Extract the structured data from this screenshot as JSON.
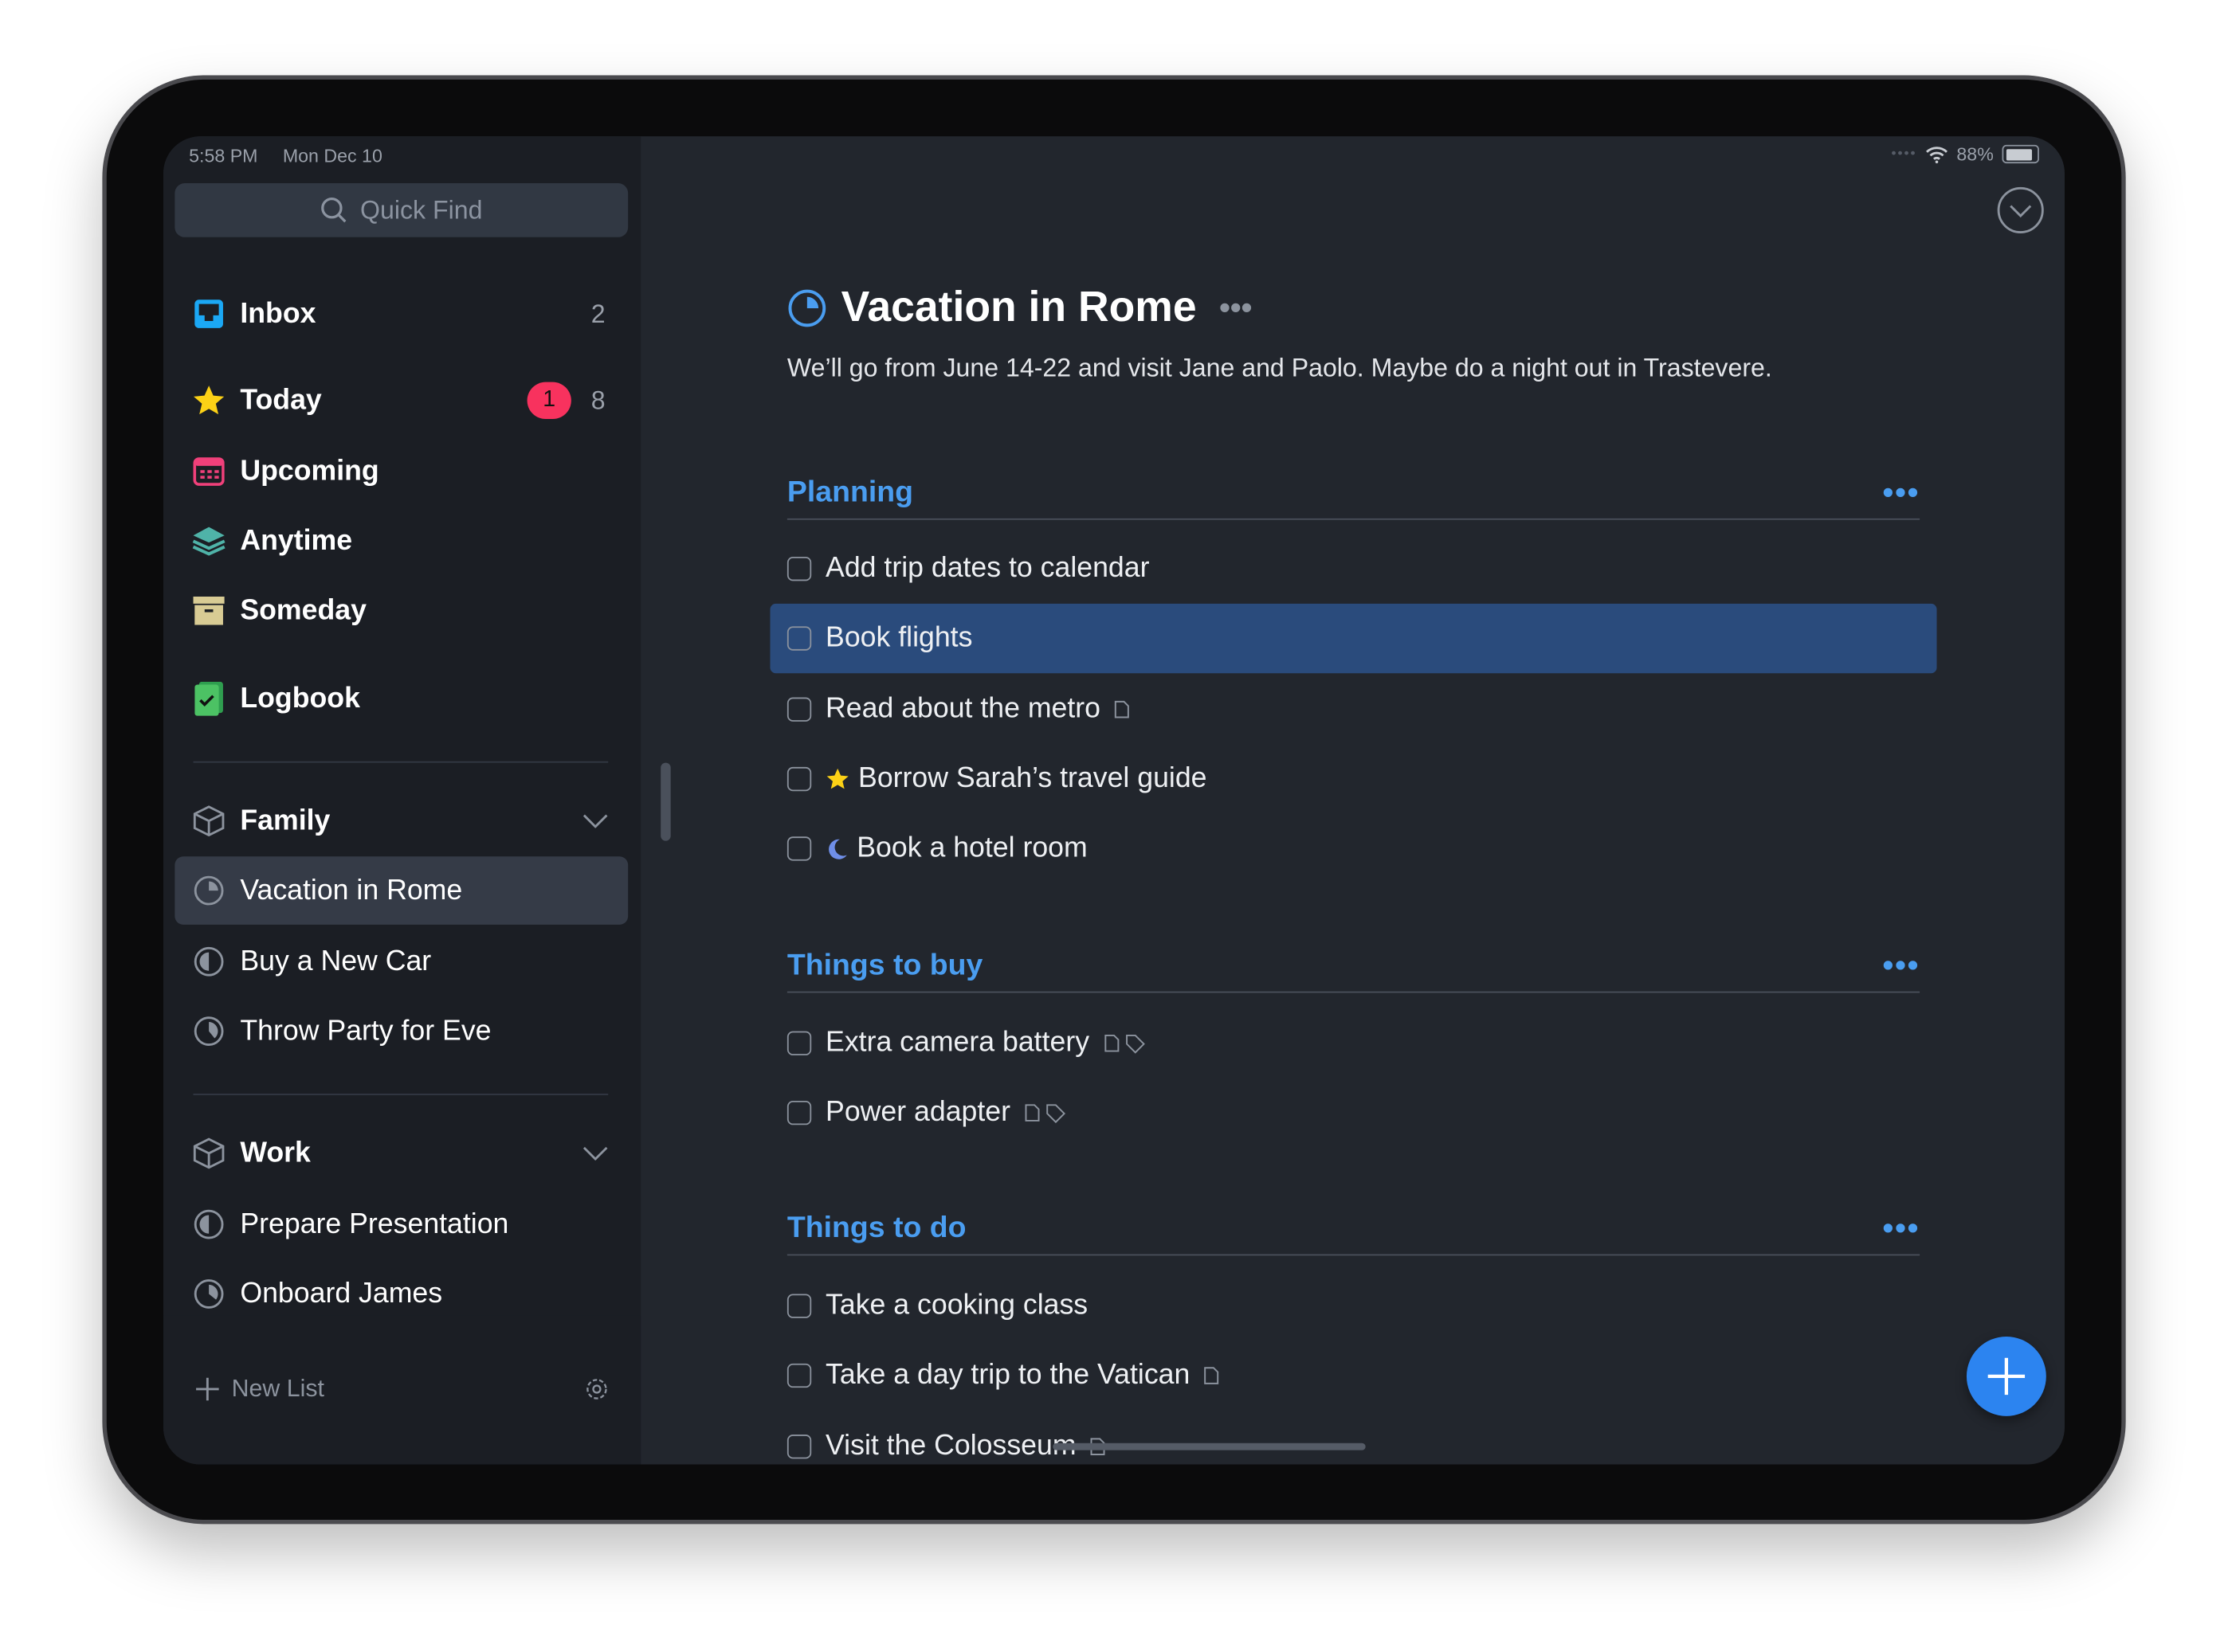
{
  "status": {
    "time": "5:58 PM",
    "date": "Mon Dec 10",
    "battery": "88%",
    "battery_level": 0.88
  },
  "sidebar": {
    "search_placeholder": "Quick Find",
    "nav": [
      {
        "label": "Inbox",
        "count": "2",
        "icon": "inbox-icon"
      },
      {
        "label": "Today",
        "badge": "1",
        "count": "8",
        "icon": "star-icon"
      },
      {
        "label": "Upcoming",
        "icon": "calendar-icon"
      },
      {
        "label": "Anytime",
        "icon": "layers-icon"
      },
      {
        "label": "Someday",
        "icon": "archive-box-icon"
      },
      {
        "label": "Logbook",
        "icon": "logbook-icon"
      }
    ],
    "areas": [
      {
        "label": "Family",
        "projects": [
          {
            "label": "Vacation in Rome",
            "progress": 0.25
          },
          {
            "label": "Buy a New Car",
            "progress": 0.5
          },
          {
            "label": "Throw Party for Eve",
            "progress": 0.4
          }
        ]
      },
      {
        "label": "Work",
        "projects": [
          {
            "label": "Prepare Presentation",
            "progress": 0.5
          },
          {
            "label": "Onboard James",
            "progress": 0.35
          }
        ]
      }
    ],
    "new_list": "New List"
  },
  "project": {
    "title": "Vacation in Rome",
    "progress": 0.25,
    "notes": "We’ll go from June 14-22 and visit Jane and Paolo. Maybe do a night out in Trastevere.",
    "sections": [
      {
        "heading": "Planning",
        "todos": [
          {
            "label": "Add trip dates to calendar"
          },
          {
            "label": "Book flights",
            "selected": true
          },
          {
            "label": "Read about the metro",
            "note": true
          },
          {
            "label": "Borrow Sarah’s travel guide",
            "today": true
          },
          {
            "label": "Book a hotel room",
            "evening": true
          }
        ]
      },
      {
        "heading": "Things to buy",
        "todos": [
          {
            "label": "Extra camera battery",
            "note": true,
            "tag": true
          },
          {
            "label": "Power adapter",
            "note": true,
            "tag": true
          }
        ]
      },
      {
        "heading": "Things to do",
        "todos": [
          {
            "label": "Take a cooking class"
          },
          {
            "label": "Take a day trip to the Vatican",
            "note": true
          },
          {
            "label": "Visit the Colosseum",
            "note": true
          }
        ]
      }
    ]
  },
  "colors": {
    "accent": "#4a9df0",
    "sidebar": "#1b1e24",
    "main": "#22262d",
    "selection": "#2a4b7c",
    "badge": "#f8325e"
  }
}
